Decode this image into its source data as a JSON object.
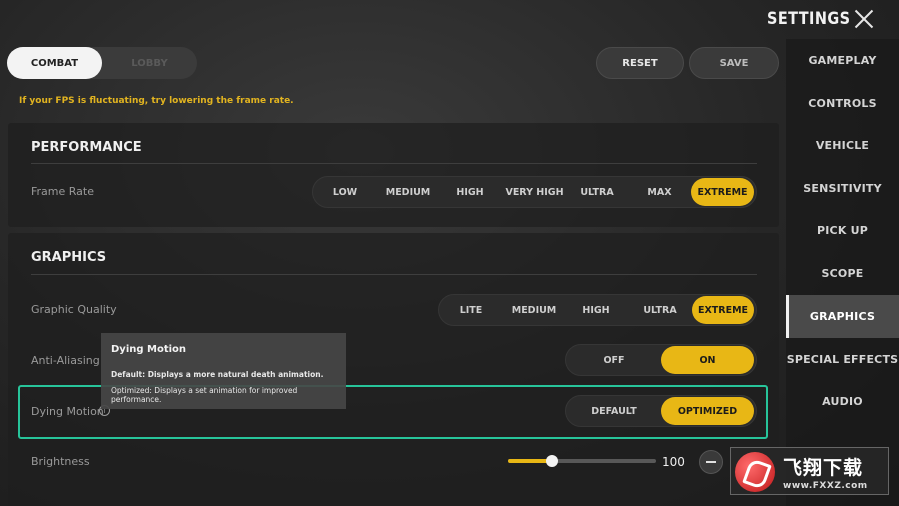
{
  "header": {
    "title": "SETTINGS"
  },
  "modes": {
    "combat": "COMBAT",
    "lobby": "LOBBY"
  },
  "actions": {
    "reset": "RESET",
    "save": "SAVE"
  },
  "hint": "If your FPS is fluctuating, try lowering the frame rate.",
  "sidebar": {
    "items": [
      {
        "label": "GAMEPLAY"
      },
      {
        "label": "CONTROLS"
      },
      {
        "label": "VEHICLE"
      },
      {
        "label": "SENSITIVITY"
      },
      {
        "label": "PICK UP"
      },
      {
        "label": "SCOPE"
      },
      {
        "label": "GRAPHICS"
      },
      {
        "label": "SPECIAL EFFECTS"
      },
      {
        "label": "AUDIO"
      }
    ],
    "active": "GRAPHICS"
  },
  "performance": {
    "title": "PERFORMANCE",
    "frame_rate": {
      "label": "Frame Rate",
      "options": [
        "LOW",
        "MEDIUM",
        "HIGH",
        "VERY HIGH",
        "ULTRA",
        "MAX",
        "EXTREME"
      ],
      "selected": "EXTREME"
    }
  },
  "graphics": {
    "title": "GRAPHICS",
    "quality": {
      "label": "Graphic Quality",
      "options": [
        "LITE",
        "MEDIUM",
        "HIGH",
        "ULTRA",
        "EXTREME"
      ],
      "selected": "EXTREME"
    },
    "anti_aliasing": {
      "label": "Anti-Aliasing",
      "options": [
        "OFF",
        "ON"
      ],
      "selected": "ON"
    },
    "dying_motion": {
      "label": "Dying Motion",
      "options": [
        "DEFAULT",
        "OPTIMIZED"
      ],
      "selected": "OPTIMIZED"
    },
    "brightness": {
      "label": "Brightness",
      "value": "100",
      "fraction": 0.3
    }
  },
  "tooltip": {
    "title": "Dying Motion",
    "line1": "Default: Displays a more natural death animation.",
    "line2": "Optimized: Displays a set animation for improved performance."
  },
  "watermark": {
    "text": "飞翔下载",
    "url": "www.FXXZ.com"
  },
  "colors": {
    "accent": "#e8b715",
    "highlight": "#27c49a",
    "hint": "#e2b420"
  }
}
